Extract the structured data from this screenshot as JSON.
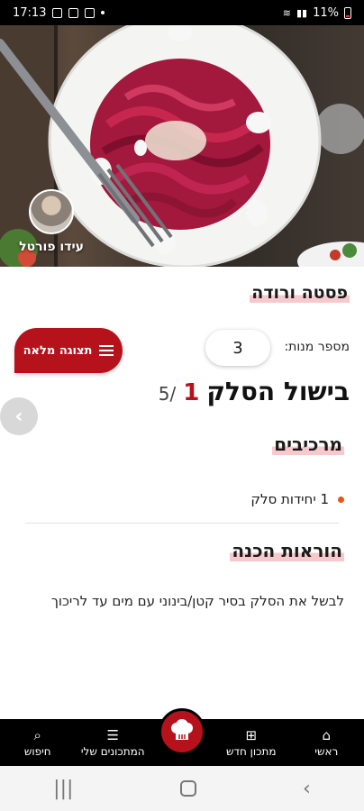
{
  "status_bar": {
    "time": "17:13",
    "battery": "11%"
  },
  "author": {
    "name": "עידו פורטל"
  },
  "recipe": {
    "title": "פסטה ורודה"
  },
  "servings": {
    "label": "מספר מנות:",
    "value": "3"
  },
  "full_view_button": {
    "label": "תצוגה מלאה"
  },
  "step": {
    "current": "1",
    "total": "/5",
    "title": "בישול הסלק"
  },
  "ingredients": {
    "title": "מרכיבים",
    "items": [
      {
        "text": "1 יחידות סלק"
      }
    ]
  },
  "instructions": {
    "title": "הוראות הכנה",
    "text": "לבשל את הסלק בסיר קטן/בינוני עם מים עד לריכוך"
  },
  "bottom_nav": {
    "items": [
      {
        "label": "ראשי",
        "icon": "home-icon"
      },
      {
        "label": "מתכון חדש",
        "icon": "add-recipe-icon"
      },
      {
        "label": "",
        "icon": "chef-hat-icon"
      },
      {
        "label": "המתכונים שלי",
        "icon": "burger-icon"
      },
      {
        "label": "חיפוש",
        "icon": "search-icon"
      }
    ]
  },
  "colors": {
    "accent": "#b5121b",
    "highlight": "#f7c9cd",
    "bullet": "#e0581c"
  }
}
